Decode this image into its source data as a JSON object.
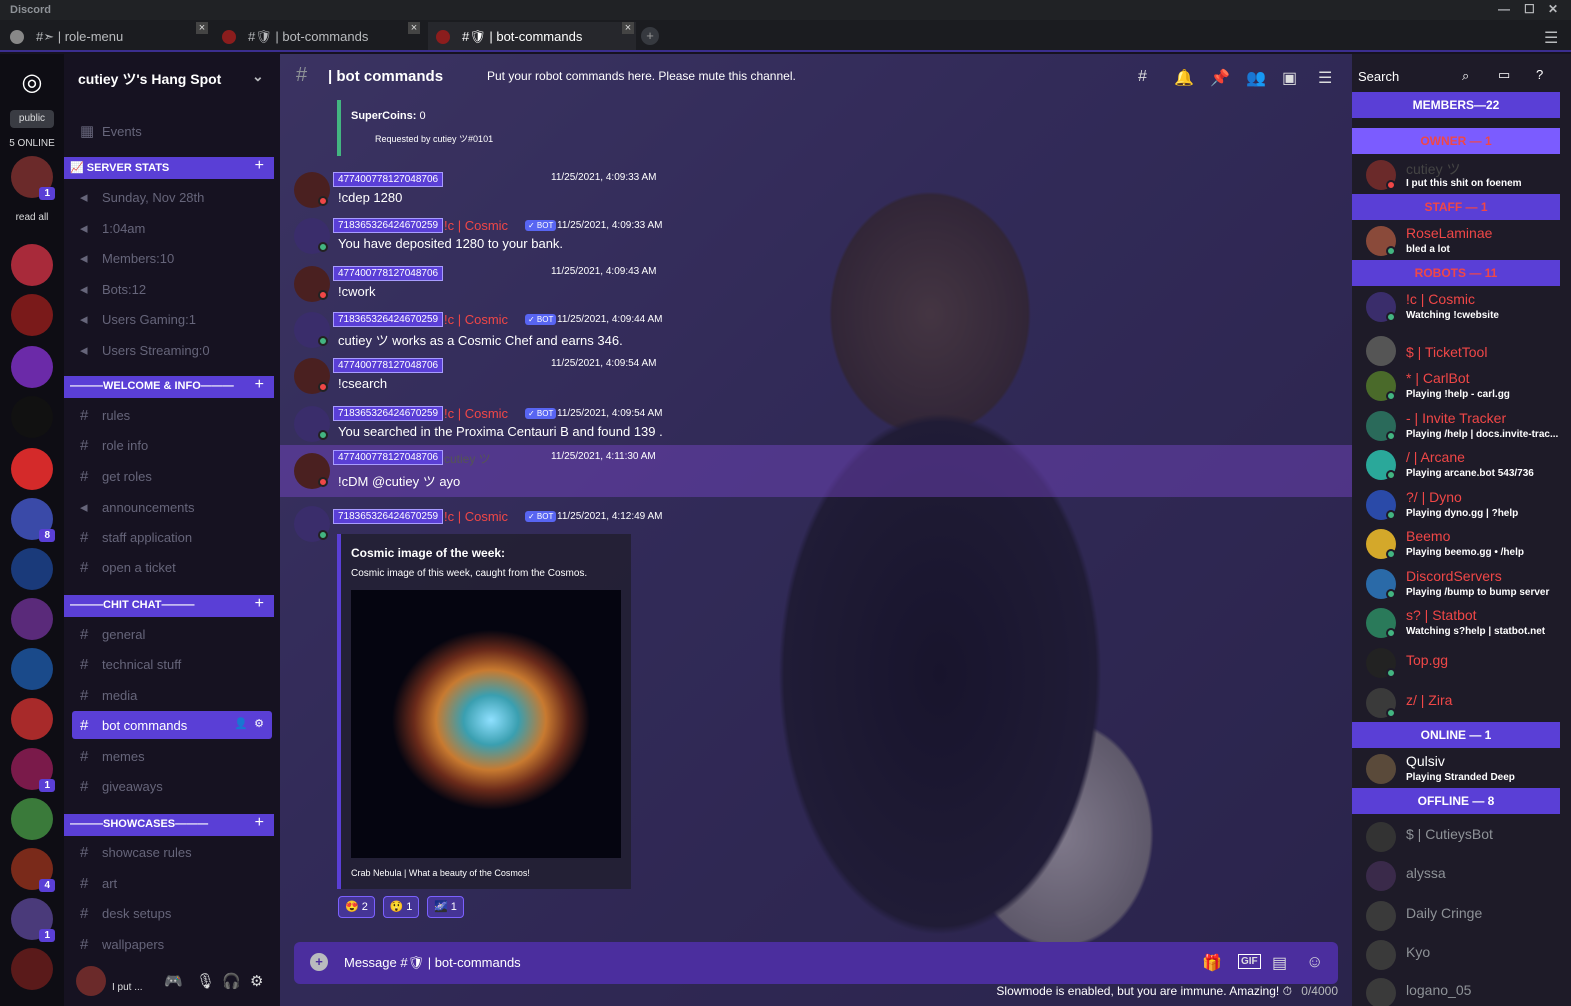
{
  "app": {
    "title": "Discord"
  },
  "tabs": [
    {
      "label": "#➣ | role-menu"
    },
    {
      "label": "#🛡 | bot-commands"
    },
    {
      "label": "#🛡 | bot-commands"
    }
  ],
  "guilds": {
    "public_label": "public",
    "online": "5 ONLINE",
    "read_all": "read all",
    "badges": [
      "1",
      "8",
      "1",
      "4",
      "1"
    ]
  },
  "server": {
    "name": "cutiey ツ's Hang Spot",
    "events": "Events"
  },
  "categories": [
    {
      "name": "📈 SERVER STATS",
      "channels": [
        "Sunday, Nov 28th",
        "1:04am",
        "Members:10",
        "Bots:12",
        "Users Gaming:1",
        "Users Streaming:0"
      ]
    },
    {
      "name": "———WELCOME & INFO———",
      "channels": [
        "rules",
        "role info",
        "get roles",
        "announcements",
        "staff application",
        "open a ticket"
      ]
    },
    {
      "name": "———CHIT CHAT———",
      "channels": [
        "general",
        "technical stuff",
        "media",
        "bot commands",
        "memes",
        "giveaways"
      ]
    },
    {
      "name": "———SHOWCASES———",
      "channels": [
        "showcase rules",
        "art",
        "desk setups",
        "wallpapers"
      ]
    }
  ],
  "userbar": {
    "status": "I put ..."
  },
  "channel": {
    "name": "| bot commands",
    "topic": "Put your robot commands here. Please mute this channel.",
    "search_placeholder": "Search"
  },
  "top_embed": {
    "coins_label": "SuperCoins:",
    "coins": "0",
    "requested": "Requested by cutiey ツ#0101"
  },
  "messages": [
    {
      "id": "477400778127048706",
      "time": "11/25/2021, 4:09:33 AM",
      "text": "!cdep 1280",
      "bot": false
    },
    {
      "id": "718365326424670259",
      "user": "!c | Cosmic",
      "time": "11/25/2021, 4:09:33 AM",
      "text": "You have deposited 1280 to your bank.",
      "bot": true
    },
    {
      "id": "477400778127048706",
      "time": "11/25/2021, 4:09:43 AM",
      "text": "!cwork",
      "bot": false
    },
    {
      "id": "718365326424670259",
      "user": "!c | Cosmic",
      "time": "11/25/2021, 4:09:44 AM",
      "text": "cutiey ツ works as a Cosmic Chef and earns 346.",
      "bot": true
    },
    {
      "id": "477400778127048706",
      "time": "11/25/2021, 4:09:54 AM",
      "text": "!csearch",
      "bot": false
    },
    {
      "id": "718365326424670259",
      "user": "!c | Cosmic",
      "time": "11/25/2021, 4:09:54 AM",
      "text": "You searched in the Proxima Centauri B and found 139 .",
      "bot": true
    },
    {
      "id": "477400778127048706",
      "user": "cutiey ツ",
      "time": "11/25/2021, 4:11:30 AM",
      "text": "!cDM @cutiey ツ ayo",
      "bot": false
    },
    {
      "id": "718365326424670259",
      "user": "!c | Cosmic",
      "time": "11/25/2021, 4:12:49 AM",
      "text": "",
      "bot": true
    }
  ],
  "embed": {
    "title": "Cosmic image of the week:",
    "desc": "Cosmic image of this week, caught from the Cosmos.",
    "footer": "Crab Nebula | What a beauty of the Cosmos!"
  },
  "reactions": [
    {
      "emoji": "😍",
      "count": "2"
    },
    {
      "emoji": "😲",
      "count": "1"
    },
    {
      "emoji": "🌌",
      "count": "1"
    }
  ],
  "bot_tag": "✓ BOT",
  "composer": {
    "placeholder": "Message #🛡 | bot-commands",
    "slowmode": "Slowmode is enabled, but you are immune. Amazing!",
    "count": "0/4000"
  },
  "members": {
    "header": "MEMBERS—22",
    "groups": [
      {
        "label": "OWNER — 1",
        "members": [
          {
            "name": "cutiey ツ",
            "activity": "I put this shit on foenem"
          }
        ]
      },
      {
        "label": "STAFF — 1",
        "members": [
          {
            "name": "RoseLaminae",
            "activity": "bled a lot"
          }
        ]
      },
      {
        "label": "ROBOTS — 11",
        "members": [
          {
            "name": "!c | Cosmic",
            "activity": "Watching !cwebsite"
          },
          {
            "name": "$ | TicketTool",
            "activity": ""
          },
          {
            "name": "* | CarlBot",
            "activity": "Playing !help - carl.gg"
          },
          {
            "name": "- | Invite Tracker",
            "activity": "Playing /help | docs.invite-trac..."
          },
          {
            "name": "/ | Arcane",
            "activity": "Playing arcane.bot 543/736"
          },
          {
            "name": "?/ | Dyno",
            "activity": "Playing dyno.gg | ?help"
          },
          {
            "name": "Beemo",
            "activity": "Playing beemo.gg • /help"
          },
          {
            "name": "DiscordServers",
            "activity": "Playing /bump to bump server"
          },
          {
            "name": "s? | Statbot",
            "activity": "Watching s?help | statbot.net"
          },
          {
            "name": "Top.gg",
            "activity": ""
          },
          {
            "name": "z/ | Zira",
            "activity": ""
          }
        ]
      },
      {
        "label": "ONLINE — 1",
        "members": [
          {
            "name": "Qulsiv",
            "activity": "Playing Stranded Deep"
          }
        ]
      },
      {
        "label": "OFFLINE — 8",
        "members": [
          {
            "name": "$ | CutieysBot",
            "activity": ""
          },
          {
            "name": "alyssa",
            "activity": ""
          },
          {
            "name": "Daily Cringe",
            "activity": ""
          },
          {
            "name": "Kyo",
            "activity": ""
          },
          {
            "name": "logano_05",
            "activity": ""
          }
        ]
      }
    ]
  }
}
